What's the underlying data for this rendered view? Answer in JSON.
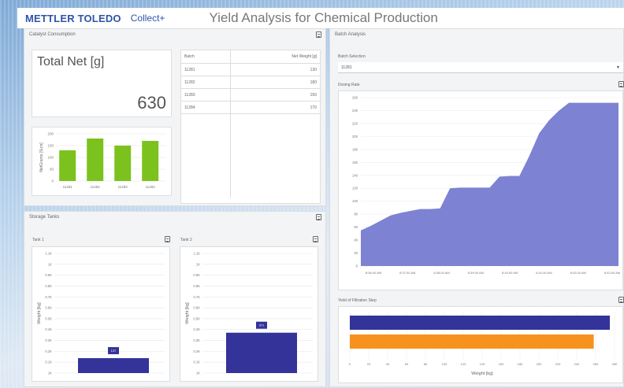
{
  "header": {
    "brand": "METTLER TOLEDO",
    "product": "Collect+",
    "title": "Yield Analysis for Chemical Production"
  },
  "catalyst": {
    "title": "Catalyst Consumption",
    "kpi_label": "Total Net [g]",
    "kpi_value": "630",
    "table": {
      "columns": [
        "Batch",
        "Net Weight [g]"
      ],
      "rows": [
        {
          "batch": "11281",
          "weight": "130"
        },
        {
          "batch": "11282",
          "weight": "180"
        },
        {
          "batch": "11283",
          "weight": "150"
        },
        {
          "batch": "11284",
          "weight": "170"
        }
      ]
    }
  },
  "storage": {
    "title": "Storage Tanks",
    "tank1": {
      "label": "Tank 1",
      "bar_label": "137"
    },
    "tank2": {
      "label": "Tank 2",
      "bar_label": "371"
    }
  },
  "batch_analysis": {
    "title": "Batch Analysis",
    "selector_label": "Batch Selection",
    "selector_value": "11281",
    "dosing_title": "Dosing Rate",
    "yield_title": "Yield of Filtration Step"
  },
  "colors": {
    "brand": "#2f54a8",
    "green": "#7cc21e",
    "navy": "#33339a",
    "area": "#7d82d2",
    "orange": "#f7921e"
  },
  "chart_data": [
    {
      "type": "bar",
      "categories": [
        "11281",
        "11282",
        "11283",
        "11284"
      ],
      "values": [
        130,
        180,
        150,
        170
      ],
      "ylabel": "NetGrams [Sum]",
      "yticks": [
        "0",
        "50",
        "100",
        "150",
        "200"
      ],
      "ylim": [
        0,
        200
      ]
    },
    {
      "type": "bar",
      "categories": [
        ""
      ],
      "values": [
        137
      ],
      "data_labels": [
        "137"
      ],
      "ylabel": "Weight [kg]",
      "yticks": [
        "1K",
        "0.1K",
        "0.2K",
        "0.3K",
        "0.4K",
        "0.5K",
        "0.6K",
        "0.7K",
        "0.8K",
        "0.9K",
        "1K",
        "1.1K"
      ],
      "ylim": [
        0,
        1100
      ]
    },
    {
      "type": "bar",
      "categories": [
        ""
      ],
      "values": [
        371
      ],
      "data_labels": [
        "371"
      ],
      "ylabel": "Weight [kg]",
      "yticks": [
        "1K",
        "0.1K",
        "0.2K",
        "0.3K",
        "0.4K",
        "0.5K",
        "0.6K",
        "0.7K",
        "0.8K",
        "0.9K",
        "1K",
        "1.1K"
      ],
      "ylim": [
        0,
        1100
      ]
    },
    {
      "type": "area",
      "x": [
        "8:30:00 AM",
        "8:30:15 AM",
        "8:30:30 AM",
        "8:30:45 AM",
        "8:31:00 AM",
        "8:31:15 AM",
        "8:31:30 AM",
        "8:31:45 AM",
        "8:32:00 AM",
        "8:32:15 AM",
        "8:32:30 AM",
        "8:32:45 AM",
        "8:33:00 AM",
        "8:33:15 AM",
        "8:33:30 AM",
        "8:33:45 AM",
        "8:34:00 AM",
        "8:34:15 AM",
        "8:34:30 AM",
        "8:34:45 AM",
        "8:35:00 AM",
        "8:35:15 AM",
        "8:35:30 AM",
        "8:35:45 AM",
        "8:36:00 AM",
        "8:36:15 AM",
        "8:36:30 AM"
      ],
      "values": [
        55,
        62,
        70,
        78,
        82,
        85,
        88,
        88,
        89,
        120,
        121,
        121,
        121,
        121,
        138,
        139,
        139,
        170,
        205,
        225,
        240,
        252,
        252,
        252,
        252,
        252,
        252
      ],
      "xticks": [
        "8:36:00 AM",
        "8:37:00 AM",
        "8:38:00 AM",
        "8:39:00 AM",
        "8:40:00 AM",
        "8:41:00 AM",
        "8:42:00 AM",
        "8:43:00 AM"
      ],
      "yticks": [
        "0",
        "20",
        "40",
        "60",
        "80",
        "100",
        "120",
        "140",
        "160",
        "180",
        "200",
        "220",
        "240",
        "260"
      ],
      "ylim": [
        0,
        260
      ]
    },
    {
      "type": "bar",
      "orientation": "horizontal",
      "values": [
        275,
        258
      ],
      "colors": [
        "#33339a",
        "#f7921e"
      ],
      "xlabel": "Weight [kg]",
      "xticks": [
        "0",
        "20",
        "40",
        "60",
        "80",
        "100",
        "120",
        "140",
        "160",
        "180",
        "200",
        "220",
        "240",
        "260",
        "280"
      ],
      "xlim": [
        0,
        280
      ]
    }
  ]
}
